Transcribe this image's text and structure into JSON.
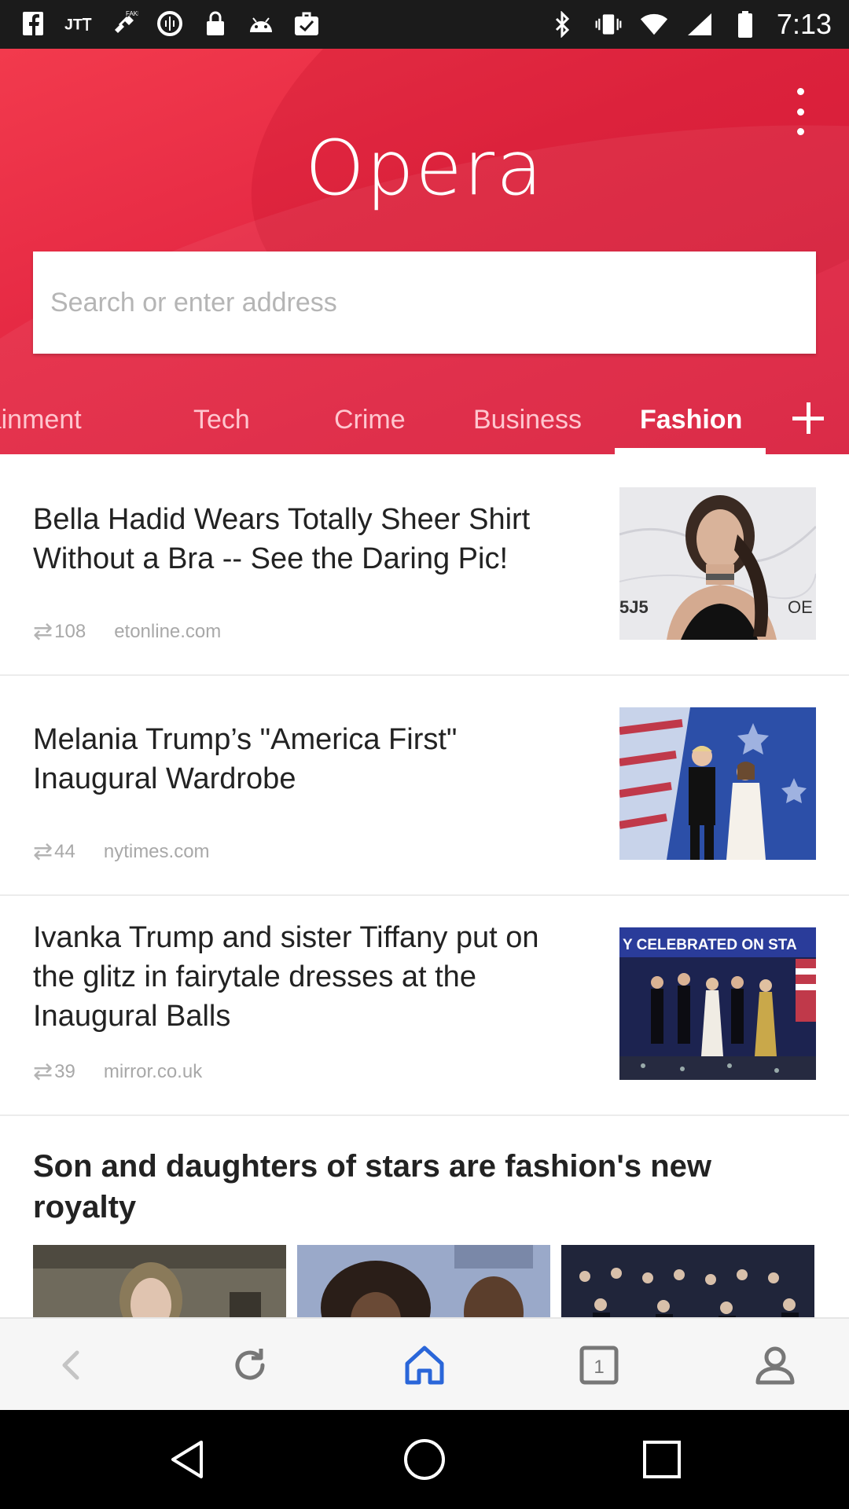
{
  "status_bar": {
    "time": "7:13",
    "left_icons": [
      "facebook-icon",
      "jt-icon",
      "fake-gps-icon",
      "data-saver-icon",
      "lock-icon",
      "android-icon",
      "clipboard-check-icon"
    ],
    "right_icons": [
      "bluetooth-icon",
      "vibrate-icon",
      "wifi-icon",
      "signal-icon",
      "battery-icon"
    ]
  },
  "header": {
    "logo": "Opera",
    "brand_color": "#e8263f",
    "menu_icon": "more-vertical-icon"
  },
  "search": {
    "placeholder": "Search or enter address",
    "value": ""
  },
  "tabs": {
    "items": [
      {
        "label": "Entertainment"
      },
      {
        "label": "Tech"
      },
      {
        "label": "Crime"
      },
      {
        "label": "Business"
      },
      {
        "label": "Fashion"
      }
    ],
    "active": "Fashion",
    "add_icon": "plus-icon"
  },
  "feed": {
    "articles": [
      {
        "title": "Bella Hadid Wears Totally Sheer Shirt Without a Bra -- See the Daring Pic!",
        "shares": "108",
        "source": "etonline.com"
      },
      {
        "title": "Melania Trump’s \"America First\" Inaugural Wardrobe",
        "shares": "44",
        "source": "nytimes.com"
      },
      {
        "title": "Ivanka Trump and sister Tiffany put on the glitz in fairytale dresses at the Inaugural Balls",
        "shares": "39",
        "source": "mirror.co.uk",
        "thumb_caption": "Y CELEBRATED ON STA"
      }
    ],
    "featured": {
      "title": "Son and daughters of stars are fashion's new royalty"
    }
  },
  "bottom_nav": {
    "items": [
      "back-icon",
      "reload-icon",
      "home-icon",
      "tabs-icon",
      "profile-icon"
    ],
    "tab_count": "1",
    "active_color": "#2a66d9"
  },
  "system_nav": [
    "back-triangle-icon",
    "home-circle-icon",
    "recents-square-icon"
  ]
}
